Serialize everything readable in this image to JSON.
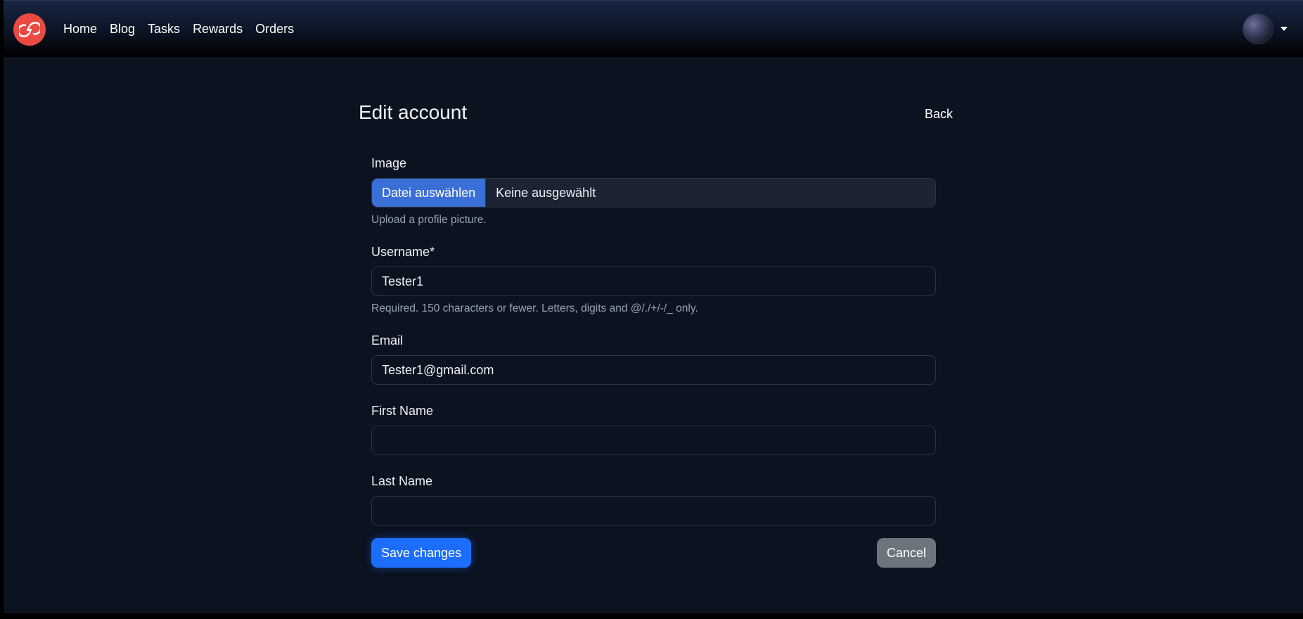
{
  "nav": {
    "brand": "brand-logo-icon",
    "links": [
      "Home",
      "Blog",
      "Tasks",
      "Rewards",
      "Orders"
    ]
  },
  "header": {
    "title": "Edit account",
    "back_label": "Back"
  },
  "form": {
    "image": {
      "label": "Image",
      "button_label": "Datei auswählen",
      "status": "Keine ausgewählt",
      "help": "Upload a profile picture."
    },
    "username": {
      "label": "Username*",
      "value": "Tester1",
      "help": "Required. 150 characters or fewer. Letters, digits and @/./+/-/_ only."
    },
    "email": {
      "label": "Email",
      "value": "Tester1@gmail.com"
    },
    "first_name": {
      "label": "First Name",
      "value": ""
    },
    "last_name": {
      "label": "Last Name",
      "value": ""
    }
  },
  "actions": {
    "save_label": "Save changes",
    "cancel_label": "Cancel"
  },
  "colors": {
    "background": "#0b1220",
    "brand": "#e94a42",
    "primary": "#1c6dfb",
    "secondary": "#6c757d",
    "file_button": "#3b6fd8"
  }
}
